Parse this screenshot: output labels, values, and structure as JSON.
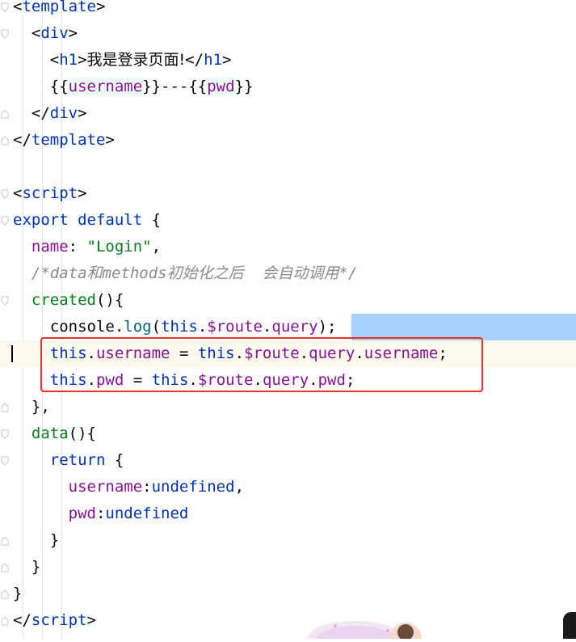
{
  "editor": {
    "lines": [
      [
        {
          "t": "<",
          "c": "plain"
        },
        {
          "t": "template",
          "c": "tagname"
        },
        {
          "t": ">",
          "c": "plain"
        }
      ],
      [
        {
          "t": "  <",
          "c": "plain"
        },
        {
          "t": "div",
          "c": "tagname"
        },
        {
          "t": ">",
          "c": "plain"
        }
      ],
      [
        {
          "t": "    <",
          "c": "plain"
        },
        {
          "t": "h1",
          "c": "tagname"
        },
        {
          "t": ">",
          "c": "plain"
        },
        {
          "t": "我是登录页面!",
          "c": "cjk"
        },
        {
          "t": "</",
          "c": "plain"
        },
        {
          "t": "h1",
          "c": "tagname"
        },
        {
          "t": ">",
          "c": "plain"
        }
      ],
      [
        {
          "t": "    {{",
          "c": "plain"
        },
        {
          "t": "username",
          "c": "interp"
        },
        {
          "t": "}}---{{",
          "c": "plain"
        },
        {
          "t": "pwd",
          "c": "interp"
        },
        {
          "t": "}}",
          "c": "plain"
        }
      ],
      [
        {
          "t": "  </",
          "c": "plain"
        },
        {
          "t": "div",
          "c": "tagname"
        },
        {
          "t": ">",
          "c": "plain"
        }
      ],
      [
        {
          "t": "</",
          "c": "plain"
        },
        {
          "t": "template",
          "c": "tagname"
        },
        {
          "t": ">",
          "c": "plain"
        }
      ],
      [],
      [
        {
          "t": "<",
          "c": "plain"
        },
        {
          "t": "script",
          "c": "tagname"
        },
        {
          "t": ">",
          "c": "plain"
        }
      ],
      [
        {
          "t": "export default",
          "c": "name"
        },
        {
          "t": " {",
          "c": "plain"
        }
      ],
      [
        {
          "t": "  ",
          "c": "plain"
        },
        {
          "t": "name",
          "c": "prop"
        },
        {
          "t": ": ",
          "c": "plain"
        },
        {
          "t": "\"Login\"",
          "c": "str"
        },
        {
          "t": ",",
          "c": "plain"
        }
      ],
      [
        {
          "t": "  ",
          "c": "plain"
        },
        {
          "t": "/*data和methods初始化之后  会自动调用*/",
          "c": "cmt"
        }
      ],
      [
        {
          "t": "  ",
          "c": "plain"
        },
        {
          "t": "created",
          "c": "str"
        },
        {
          "t": "(){",
          "c": "plain"
        }
      ],
      [
        {
          "t": "    console.",
          "c": "plain"
        },
        {
          "t": "log",
          "c": "fn"
        },
        {
          "t": "(",
          "c": "plain"
        },
        {
          "t": "this",
          "c": "name"
        },
        {
          "t": ".",
          "c": "plain"
        },
        {
          "t": "$route",
          "c": "prop"
        },
        {
          "t": ".",
          "c": "plain"
        },
        {
          "t": "query",
          "c": "prop"
        },
        {
          "t": ");",
          "c": "plain"
        }
      ],
      [
        {
          "t": "    ",
          "c": "plain"
        },
        {
          "t": "this",
          "c": "name"
        },
        {
          "t": ".",
          "c": "plain"
        },
        {
          "t": "username",
          "c": "prop"
        },
        {
          "t": " = ",
          "c": "plain"
        },
        {
          "t": "this",
          "c": "name"
        },
        {
          "t": ".",
          "c": "plain"
        },
        {
          "t": "$route",
          "c": "prop"
        },
        {
          "t": ".",
          "c": "plain"
        },
        {
          "t": "query",
          "c": "prop"
        },
        {
          "t": ".",
          "c": "plain"
        },
        {
          "t": "username",
          "c": "prop"
        },
        {
          "t": ";",
          "c": "plain"
        }
      ],
      [
        {
          "t": "    ",
          "c": "plain"
        },
        {
          "t": "this",
          "c": "name"
        },
        {
          "t": ".",
          "c": "plain"
        },
        {
          "t": "pwd",
          "c": "prop"
        },
        {
          "t": " = ",
          "c": "plain"
        },
        {
          "t": "this",
          "c": "name"
        },
        {
          "t": ".",
          "c": "plain"
        },
        {
          "t": "$route",
          "c": "prop"
        },
        {
          "t": ".",
          "c": "plain"
        },
        {
          "t": "query",
          "c": "prop"
        },
        {
          "t": ".",
          "c": "plain"
        },
        {
          "t": "pwd",
          "c": "prop"
        },
        {
          "t": ";",
          "c": "plain"
        }
      ],
      [
        {
          "t": "  },",
          "c": "plain"
        }
      ],
      [
        {
          "t": "  ",
          "c": "plain"
        },
        {
          "t": "data",
          "c": "str"
        },
        {
          "t": "(){",
          "c": "plain"
        }
      ],
      [
        {
          "t": "    ",
          "c": "plain"
        },
        {
          "t": "return",
          "c": "name"
        },
        {
          "t": " {",
          "c": "plain"
        }
      ],
      [
        {
          "t": "      ",
          "c": "plain"
        },
        {
          "t": "username",
          "c": "prop"
        },
        {
          "t": ":",
          "c": "plain"
        },
        {
          "t": "undefined",
          "c": "name"
        },
        {
          "t": ",",
          "c": "plain"
        }
      ],
      [
        {
          "t": "      ",
          "c": "plain"
        },
        {
          "t": "pwd",
          "c": "prop"
        },
        {
          "t": ":",
          "c": "plain"
        },
        {
          "t": "undefined",
          "c": "name"
        }
      ],
      [
        {
          "t": "    }",
          "c": "plain"
        }
      ],
      [
        {
          "t": "  }",
          "c": "plain"
        }
      ],
      [
        {
          "t": "}",
          "c": "plain"
        }
      ],
      [
        {
          "t": "</",
          "c": "plain"
        },
        {
          "t": "script",
          "c": "tagname"
        },
        {
          "t": ">",
          "c": "plain"
        }
      ]
    ],
    "fold_markers": [
      "open",
      "open",
      "none",
      "none",
      "close",
      "close",
      "none",
      "open",
      "open",
      "none",
      "none",
      "open",
      "none",
      "none",
      "none",
      "close",
      "open",
      "open",
      "none",
      "none",
      "close",
      "close",
      "close",
      "close"
    ],
    "highlight_color": "#e8312f",
    "selection_color": "#a6d2ff"
  }
}
